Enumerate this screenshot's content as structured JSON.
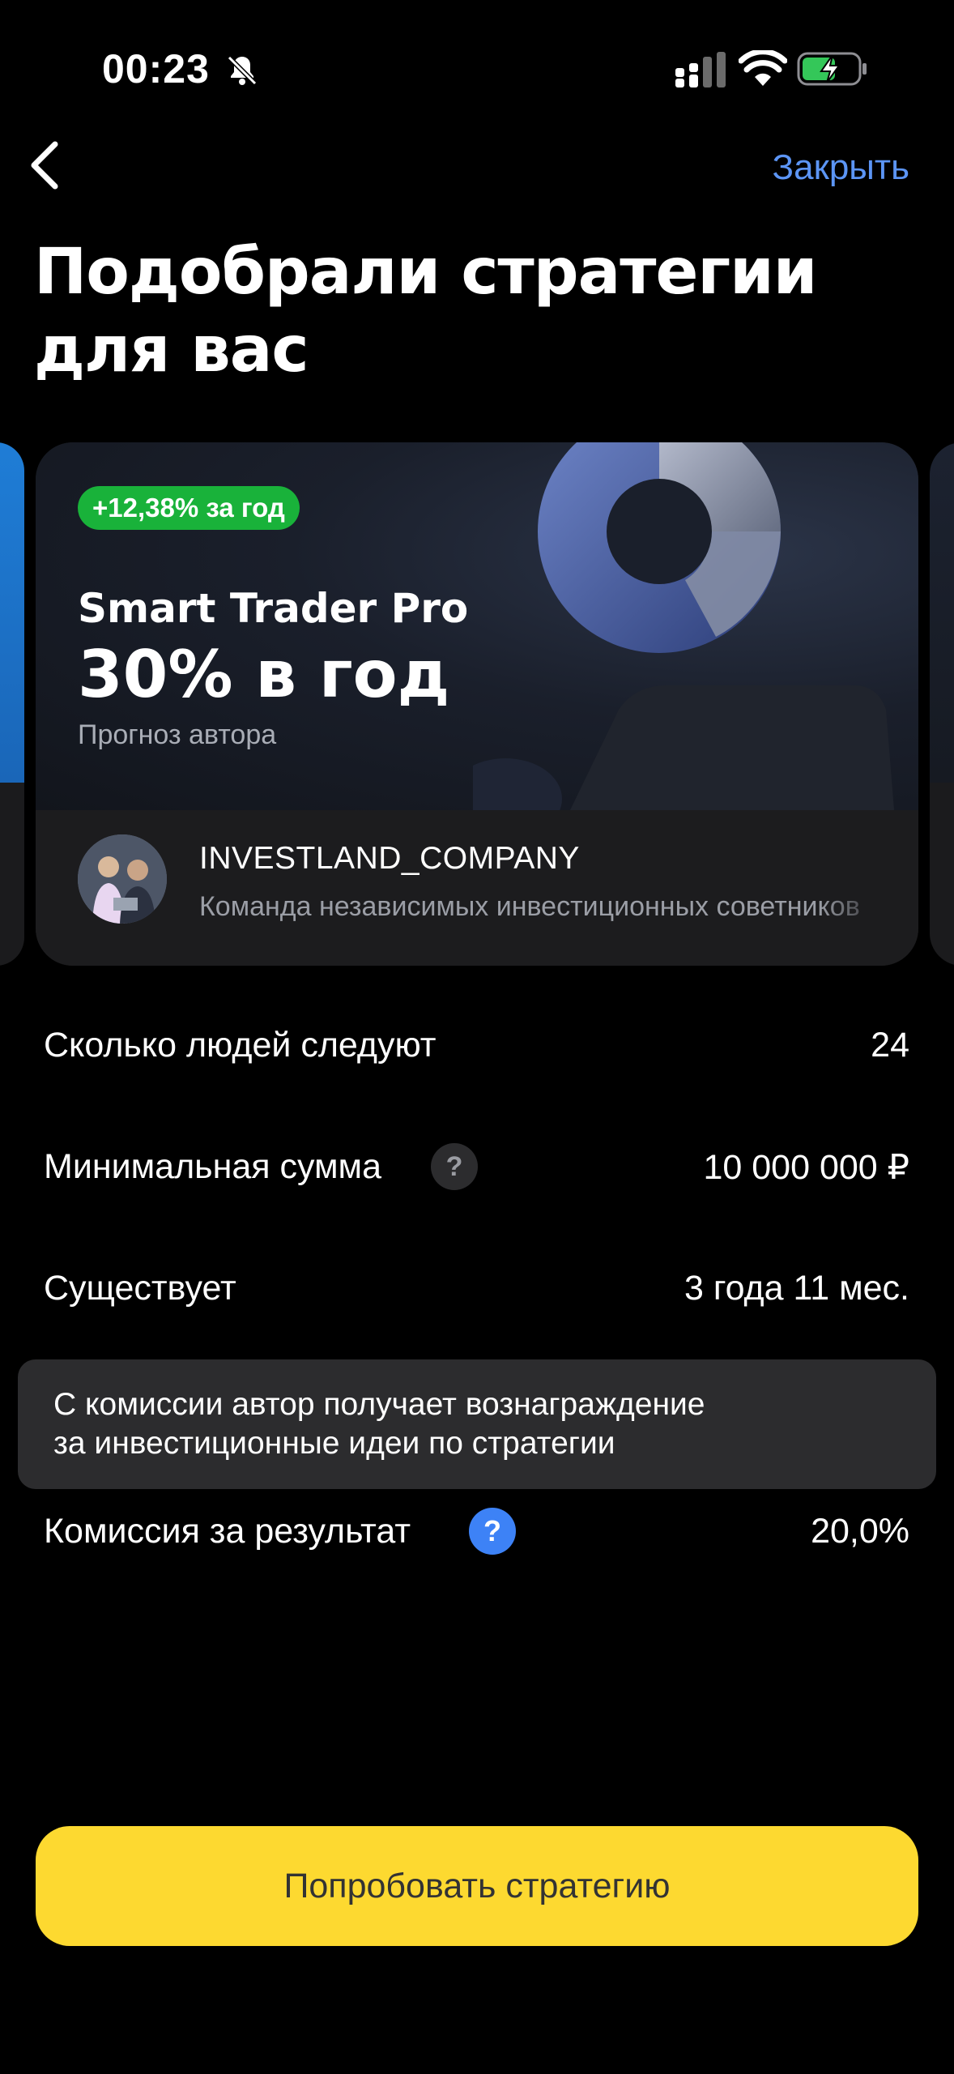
{
  "status_bar": {
    "time": "00:23",
    "icons": [
      "bell-off-icon",
      "cellular-signal-icon",
      "wifi-icon",
      "battery-charging-icon"
    ]
  },
  "nav": {
    "back_icon": "chevron-left-icon",
    "close_label": "Закрыть"
  },
  "title": "Подобрали стратегии для вас",
  "strategy_card": {
    "return_badge": "+12,38% за год",
    "name": "Smart Trader Pro",
    "forecast": "30% в год",
    "forecast_caption": "Прогноз автора",
    "author": {
      "name": "INVESTLAND_COMPANY",
      "description": "Команда независимых инвестиционных советников"
    }
  },
  "details": {
    "followers": {
      "label": "Сколько людей следуют",
      "value": "24"
    },
    "min_amount": {
      "label": "Минимальная сумма",
      "value": "10 000 000 ₽"
    },
    "exists": {
      "label": "Существует",
      "value": "3 года 11 мес."
    },
    "tooltip": {
      "line1": "С комиссии автор получает вознаграждение",
      "line2": "за инвестиционные идеи по стратегии"
    },
    "commission": {
      "label": "Комиссия за результат",
      "value": "20,0%"
    },
    "help_glyph": "?"
  },
  "cta_label": "Попробовать стратегию",
  "colors": {
    "accent_blue": "#5c95f5",
    "badge_green": "#19b23a",
    "cta_yellow": "#fdd930",
    "help_blue": "#3d82f6"
  }
}
